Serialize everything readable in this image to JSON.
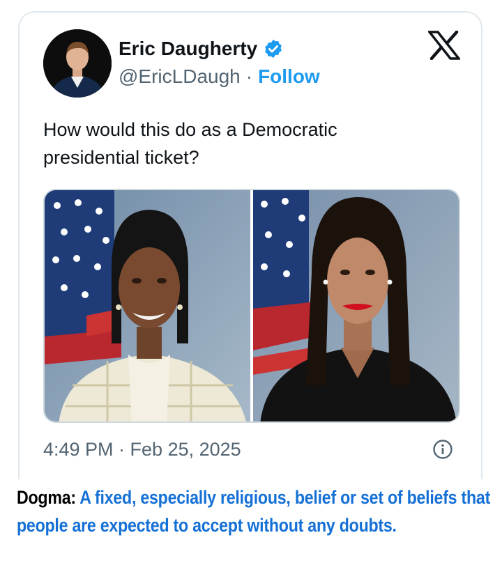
{
  "tweet": {
    "author_name": "Eric Daugherty",
    "handle": "@EricLDaugh",
    "separator": "·",
    "follow_label": "Follow",
    "text": "How would this do as a Democratic presidential ticket?",
    "timestamp": "4:49 PM · Feb 25, 2025",
    "icons": {
      "verified": "verified-badge-icon",
      "platform": "x-logo-icon",
      "info": "info-icon"
    },
    "media": [
      {
        "description": "portrait-photo-left"
      },
      {
        "description": "portrait-photo-right"
      }
    ]
  },
  "caption": {
    "term": "Dogma:",
    "definition": "A fixed, especially religious, belief or set of beliefs that people are expected to accept without any doubts."
  },
  "colors": {
    "link": "#1d9bf0",
    "secondary_text": "#536471",
    "definition_text": "#1570d6"
  }
}
